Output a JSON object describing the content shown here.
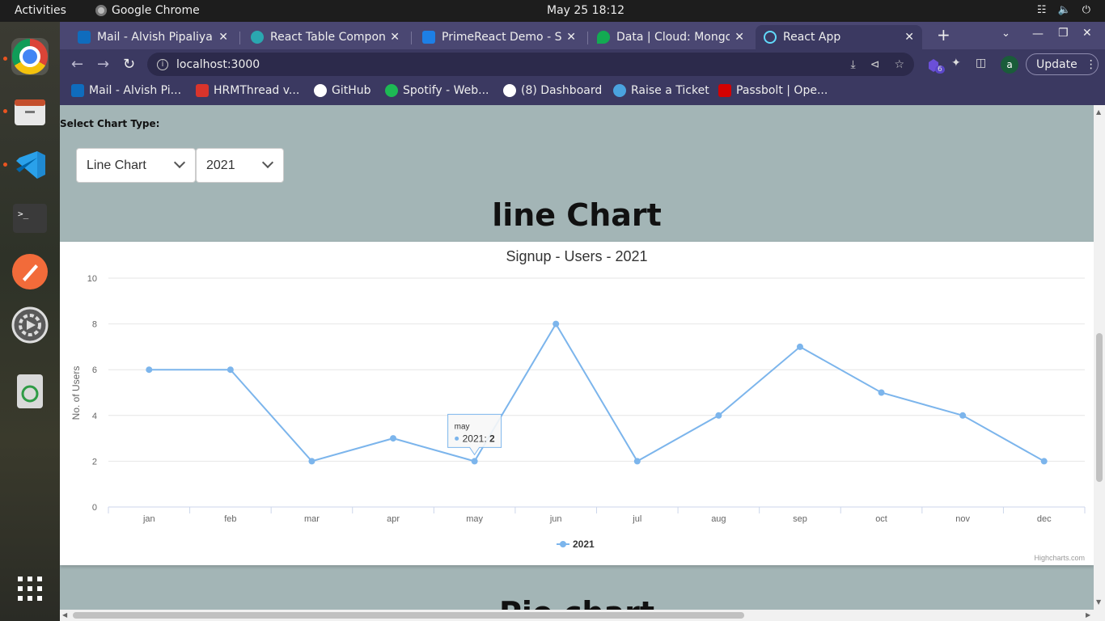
{
  "topbar": {
    "activities": "Activities",
    "app_name": "Google Chrome",
    "clock": "May 25  18:12"
  },
  "tabs": [
    {
      "title": "Mail - Alvish Pipaliya - ",
      "favicon_color": "#0f6cbd"
    },
    {
      "title": "React Table Compone",
      "favicon_color": "#2aa7b0"
    },
    {
      "title": "PrimeReact Demo - St",
      "favicon_color": "#1d7fe6"
    },
    {
      "title": "Data | Cloud: MongoD",
      "favicon_color": "#13aa52"
    },
    {
      "title": "React App",
      "favicon_color": "#61dafb"
    }
  ],
  "toolbar": {
    "url": "localhost:3000",
    "profile_initial": "a",
    "update_label": "Update",
    "extension_badge": "6"
  },
  "bookmarks": [
    {
      "label": "Mail - Alvish Pi...",
      "color": "#0f6cbd"
    },
    {
      "label": "HRMThread v...",
      "color": "#d9342b"
    },
    {
      "label": "GitHub",
      "color": "#ffffff"
    },
    {
      "label": "Spotify - Web...",
      "color": "#1db954"
    },
    {
      "label": "(8) Dashboard",
      "color": "#ffffff"
    },
    {
      "label": "Raise a Ticket",
      "color": "#4aa3df"
    },
    {
      "label": "Passbolt | Ope...",
      "color": "#d40101"
    }
  ],
  "page": {
    "select_label": "Select Chart Type:",
    "chart_type_value": "Line Chart",
    "year_value": "2021",
    "title": "line Chart",
    "next_title": "Pie chart"
  },
  "chart_data": {
    "type": "line",
    "title": "Signup - Users - 2021",
    "ylabel": "No. of Users",
    "xlabel": "",
    "categories": [
      "jan",
      "feb",
      "mar",
      "apr",
      "may",
      "jun",
      "jul",
      "aug",
      "sep",
      "oct",
      "nov",
      "dec"
    ],
    "series": [
      {
        "name": "2021",
        "values": [
          6,
          6,
          2,
          3,
          2,
          8,
          2,
          4,
          7,
          5,
          4,
          2
        ],
        "color": "#7cb5ec"
      }
    ],
    "ylim": [
      0,
      10
    ],
    "yticks": [
      0,
      2,
      4,
      6,
      8,
      10
    ],
    "grid": true,
    "legend": "bottom-center",
    "credits": "Highcharts.com",
    "tooltip": {
      "category": "may",
      "series": "2021",
      "value": "2"
    }
  }
}
